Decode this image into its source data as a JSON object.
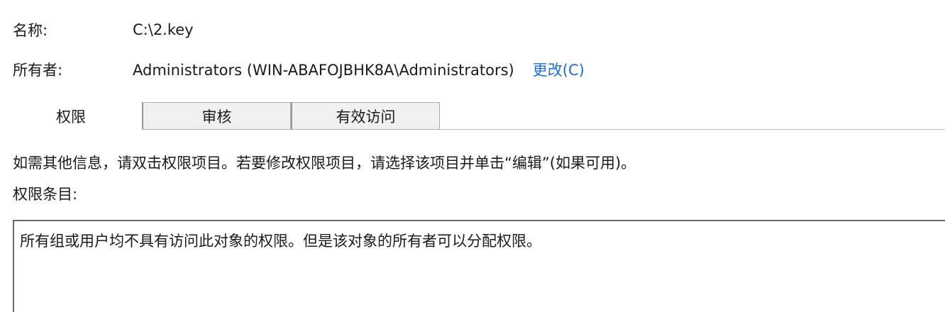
{
  "object": {
    "name_label": "名称:",
    "name_value": "C:\\2.key",
    "owner_label": "所有者:",
    "owner_value": "Administrators (WIN-ABAFOJBHK8A\\Administrators)",
    "change_link": "更改(C)"
  },
  "tabs": [
    {
      "label": "权限",
      "active": true
    },
    {
      "label": "审核",
      "active": false
    },
    {
      "label": "有效访问",
      "active": false
    }
  ],
  "permissions": {
    "info_text": "如需其他信息，请双击权限项目。若要修改权限项目，请选择该项目并单击“编辑”(如果可用)。",
    "entries_label": "权限条目:",
    "empty_message": "所有组或用户均不具有访问此对象的权限。但是该对象的所有者可以分配权限。"
  },
  "colors": {
    "link": "#1a6fd6",
    "tab_inactive_bg": "#f0f0f0",
    "border": "#6a6a6a"
  }
}
